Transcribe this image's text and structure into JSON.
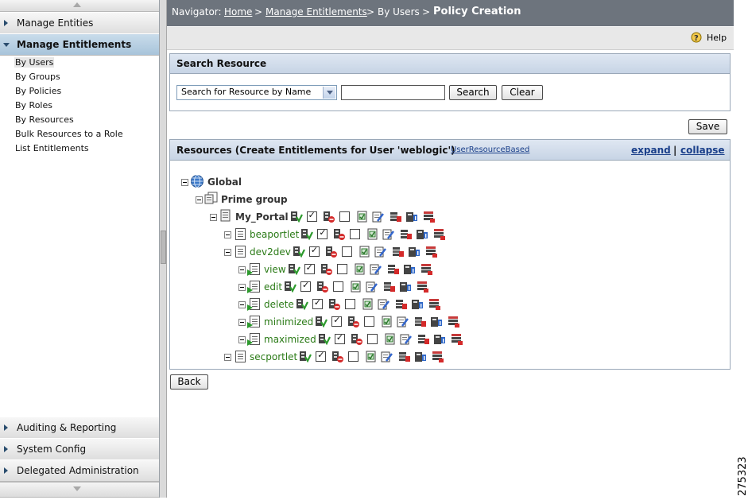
{
  "sidebar": {
    "top_sections": [
      {
        "label": "Manage Entities",
        "active": false
      },
      {
        "label": "Manage Entitlements",
        "active": true
      }
    ],
    "sub_items": [
      "By Users",
      "By Groups",
      "By Policies",
      "By Roles",
      "By Resources",
      "Bulk Resources to a Role",
      "List Entitlements"
    ],
    "selected_sub": "By Users",
    "bottom_sections": [
      "Auditing & Reporting",
      "System Config",
      "Delegated Administration"
    ]
  },
  "navigator": {
    "prefix": "Navigator:",
    "home": "Home",
    "sep": ">",
    "manage": "Manage Entitlements",
    "by_users": "By Users",
    "current": "Policy Creation"
  },
  "help_label": "Help",
  "search": {
    "title": "Search Resource",
    "select_value": "Search for Resource by Name",
    "input_value": "",
    "search_button": "Search",
    "clear_button": "Clear"
  },
  "save_button": "Save",
  "resources": {
    "title": "Resources (Create Entitlements for User 'weblogic')",
    "link": "UserResourceBased",
    "expand": "expand",
    "divider": "|",
    "collapse": "collapse"
  },
  "tree": [
    {
      "label": "Global",
      "kind": "global",
      "bold": true,
      "actions": false
    },
    {
      "label": "Prime group",
      "kind": "group",
      "bold": true,
      "actions": false
    },
    {
      "label": "My_Portal",
      "kind": "portal",
      "bold": true,
      "actions": true,
      "grant": true,
      "deny": false
    },
    {
      "label": "beaportlet",
      "kind": "doc",
      "bold": false,
      "actions": true,
      "grant": true,
      "deny": false
    },
    {
      "label": "dev2dev",
      "kind": "doc",
      "bold": false,
      "actions": true,
      "grant": true,
      "deny": false
    },
    {
      "label": "view",
      "kind": "action",
      "bold": false,
      "actions": true,
      "grant": true,
      "deny": false
    },
    {
      "label": "edit",
      "kind": "action",
      "bold": false,
      "actions": true,
      "grant": true,
      "deny": false
    },
    {
      "label": "delete",
      "kind": "action",
      "bold": false,
      "actions": true,
      "grant": true,
      "deny": false
    },
    {
      "label": "minimized",
      "kind": "action",
      "bold": false,
      "actions": true,
      "grant": true,
      "deny": false
    },
    {
      "label": "maximized",
      "kind": "action",
      "bold": false,
      "actions": true,
      "grant": true,
      "deny": false
    },
    {
      "label": "secportlet",
      "kind": "doc",
      "bold": false,
      "actions": true,
      "grant": true,
      "deny": false
    }
  ],
  "back_button": "Back",
  "figure_id": "275323",
  "colors": {
    "header_bg": "#6d747d",
    "tree_text": "#2a7a16",
    "link": "#1a3f8a",
    "active_nav": "#b4cce0"
  }
}
